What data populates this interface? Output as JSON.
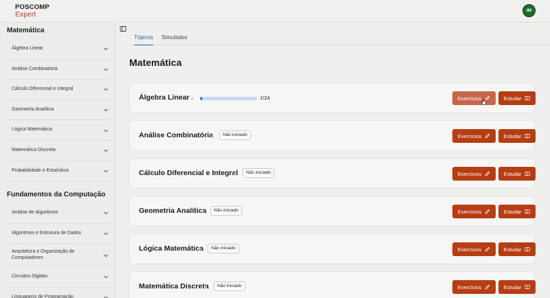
{
  "header": {
    "logo_line1": "POSCOMP",
    "logo_line2": "Expert",
    "avatar_initials": "IM",
    "avatar_color": "#1d6b2e"
  },
  "sidebar": {
    "sections": [
      {
        "title": "Matemática",
        "items": [
          "Álgebra Linear",
          "Análise Combinatória",
          "Cálculo Diferencial e Integral",
          "Geometria Analítica",
          "Lógica Matemática",
          "Matemática Discreta",
          "Probabilidade e Estatística"
        ]
      },
      {
        "title": "Fundamentos da Computação",
        "items": [
          "Análise de Algoritmos",
          "Algoritmos e Estrutura de Dados",
          "Arquitetura e Organização de Computadores",
          "Circuitos Digitais",
          "Linguagens de Programação"
        ]
      }
    ]
  },
  "main": {
    "tabs": [
      {
        "label": "Tópicos",
        "active": true
      },
      {
        "label": "Simulados",
        "active": false
      }
    ],
    "page_title": "Matemática",
    "exercise_label": "Exercícios",
    "study_label": "Estudar",
    "accent_color": "#b63d14",
    "topics": [
      {
        "title": "Álgebra Linear",
        "status": "progress",
        "progress_fraction": 0.042,
        "progress_text": "1/24"
      },
      {
        "title": "Análise Combinatória",
        "status": "Não iniciado"
      },
      {
        "title": "Cálculo Diferencial e Integral",
        "status": "Não iniciado"
      },
      {
        "title": "Geometria Analítica",
        "status": "Não iniciado"
      },
      {
        "title": "Lógica Matemática",
        "status": "Não iniciado"
      },
      {
        "title": "Matemática Discreta",
        "status": "Não iniciado"
      }
    ]
  }
}
